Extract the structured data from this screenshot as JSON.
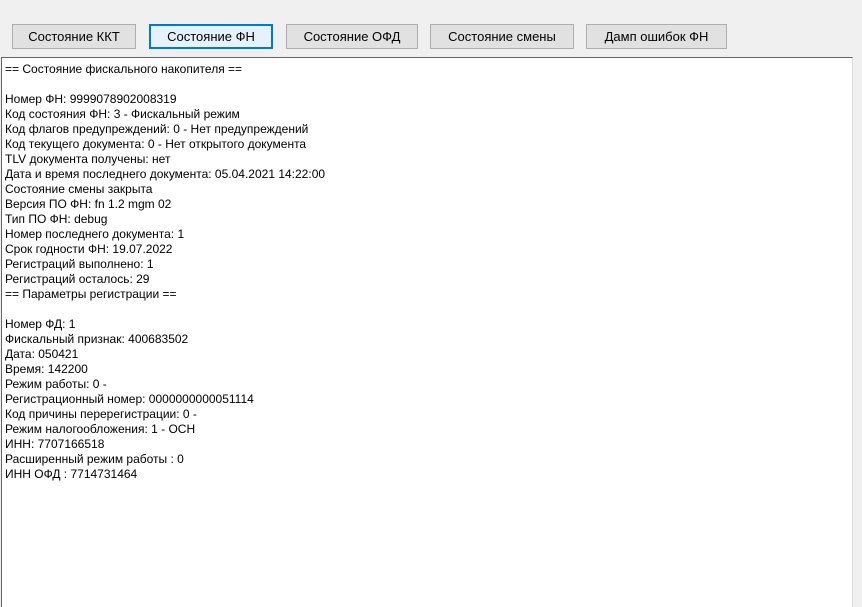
{
  "toolbar": {
    "buttons": [
      {
        "label": "Состояние ККТ"
      },
      {
        "label": "Состояние ФН"
      },
      {
        "label": "Состояние ОФД"
      },
      {
        "label": "Состояние смены"
      },
      {
        "label": "Дамп ошибок ФН"
      }
    ],
    "active_index": 1
  },
  "output": {
    "lines": [
      "== Состояние фискального накопителя ==",
      "",
      "Номер ФН: 9999078902008319",
      "Код состояния ФН: 3 - Фискальный режим",
      "Код флагов предупреждений: 0 - Нет предупреждений",
      "Код текущего документа: 0 - Нет открытого документа",
      "TLV документа получены: нет",
      "Дата и время последнего документа: 05.04.2021 14:22:00",
      "Состояние смены закрыта",
      "Версия ПО ФН: fn 1.2 mgm 02",
      "Тип ПО ФН: debug",
      "Номер последнего документа: 1",
      "Срок годности ФН: 19.07.2022",
      "Регистраций выполнено: 1",
      "Регистраций осталось: 29",
      "== Параметры регистрации ==",
      "",
      "Номер ФД: 1",
      "Фискальный признак: 400683502",
      "Дата: 050421",
      "Время: 142200",
      "Режим работы: 0 -",
      "Регистрационный номер: 0000000000051114",
      "Код причины перерегистрации: 0 -",
      "Режим налогообложения: 1 - ОСН",
      "ИНН: 7707166518",
      "Расширенный режим работы : 0",
      "ИНН ОФД : 7714731464"
    ]
  }
}
